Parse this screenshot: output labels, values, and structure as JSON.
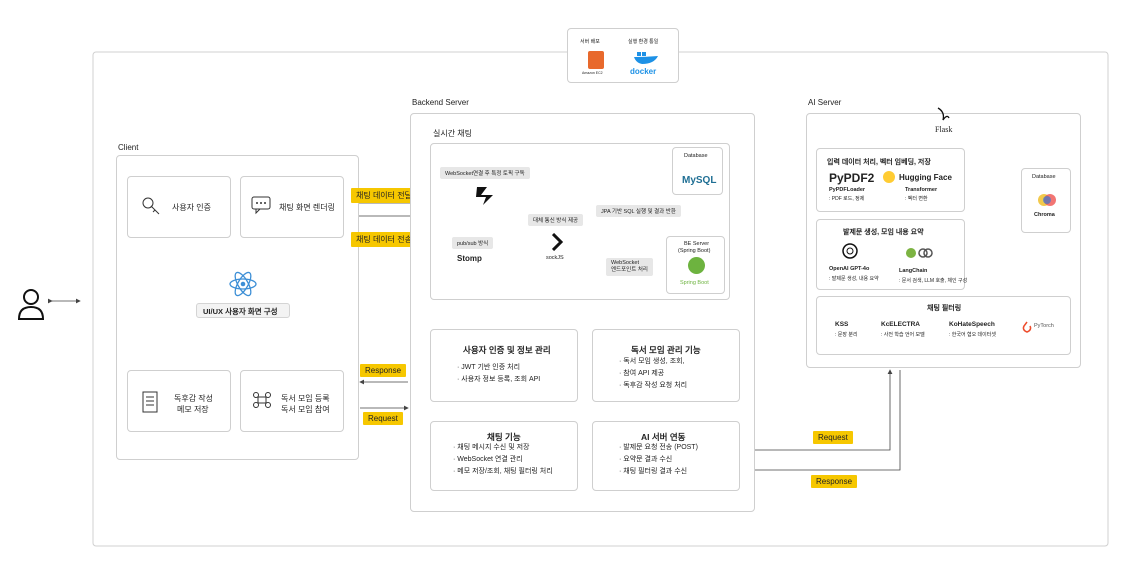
{
  "deploy": {
    "server_label": "서버 배포",
    "server_icon_text": "Amazon EC2",
    "env_label": "실행 환경 통일",
    "docker_text": "docker"
  },
  "user": {
    "icon": "person-icon"
  },
  "client": {
    "title": "Client",
    "auth": "사용자 인증",
    "chat_render": "채팅 화면 렌더링",
    "ui_label": "UI/UX 사용자 화면 구성",
    "review": [
      "독후감 작성",
      "메모 저장"
    ],
    "meeting": [
      "독서 모임 등록",
      "독서 모임 참여"
    ]
  },
  "arrows": {
    "chat_send": "채팅 데이터 전달",
    "chat_transfer": "채팅 데이터 전송",
    "response": "Response",
    "request": "Request",
    "ai_request": "Request",
    "ai_response": "Response"
  },
  "backend": {
    "title": "Backend Server",
    "realtime_title": "실시간 채팅",
    "ws_topic": "WebSocket연결 후 특정 토픽 구독",
    "pubsub": "pub/sub 방식",
    "stomp": "Stomp",
    "bidirectional": "대체 통신 방식 제공",
    "sockjs": "sockJS",
    "jpa": "JPA 기반 SQL 실행 및 결과 반환",
    "database": "Database",
    "mysql": "MySQL",
    "be_server": [
      "BE Server",
      "(Spring Boot)"
    ],
    "spring_boot": "Spring Boot",
    "ws_endpoint": [
      "WebSocket",
      "엔드포인트 처리"
    ],
    "auth_card": {
      "title": "사용자 인증 및 정보 관리",
      "items": [
        "JWT 기반 인증 처리",
        "사용자 정보 등록, 조회 API"
      ]
    },
    "meeting_card": {
      "title": "독서 모임 관리 기능",
      "items": [
        "독서 모임 생성, 조회,",
        "참여 API 제공",
        "독후감 작성 요청 처리"
      ]
    },
    "chat_card": {
      "title": "채팅 기능",
      "items": [
        "채팅 메시지 수신 및 저장",
        "WebSocket 연결 관리",
        "메모 저장/조회, 채팅 필터링 처리"
      ]
    },
    "ai_card": {
      "title": "AI 서버 연동",
      "items": [
        "발제문 요청 전송 (POST)",
        "요약문 결과 수신",
        "채팅 필터링 결과 수신"
      ]
    }
  },
  "ai": {
    "title": "AI Server",
    "flask": "Flask",
    "embed_title": "입력 데이터 처리, 벡터 임베딩, 저장",
    "pypdf": "PyPDF2",
    "pypdf_loader": "PyPDFLoader",
    "pypdf_desc": ": PDF 로드, 정제",
    "hf": "Hugging Face",
    "transformer": "Transformer",
    "transformer_desc": ": 벡터 변환",
    "gen_title": "발제문 생성, 모임 내용 요약",
    "openai": "OpenAI GPT-4o",
    "openai_desc": ": 발제문 생성, 내용 요약",
    "langchain": "LangChain",
    "langchain_desc": ": 문서 검색, LLM 호출, 체인 구성",
    "filter_title": "채팅 필터링",
    "kss": "KSS",
    "kss_desc": ": 문장 분리",
    "kcelectra": "KcELECTRA",
    "kcelectra_desc": ": 사전 학습 언어 모델",
    "kohate": "KoHateSpeech",
    "kohate_desc": ": 한국어 혐오 데이터셋",
    "pytorch": "PyTorch",
    "database": "Database",
    "chroma": "Chroma"
  },
  "colors": {
    "tag": "#f6c700",
    "aws": "#e8692c",
    "docker": "#1d91e6",
    "react": "#3d8fd6",
    "spring": "#6db33f",
    "mysql": "#1f6f94",
    "pytorch": "#ee4c2c"
  }
}
